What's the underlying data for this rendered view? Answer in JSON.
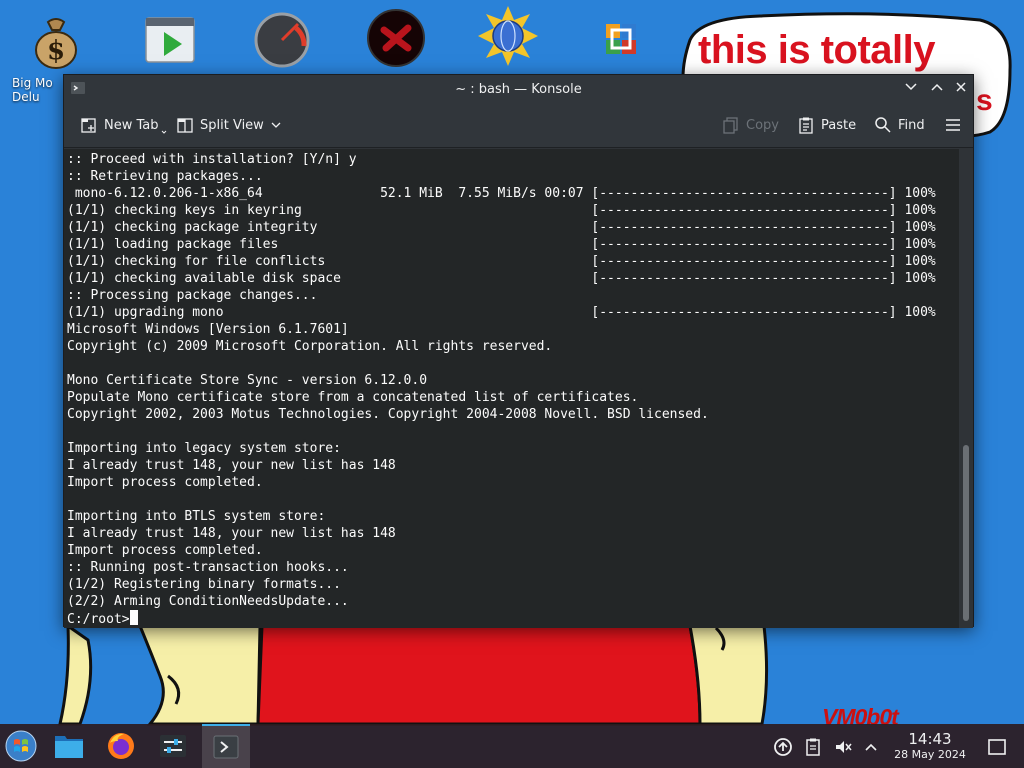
{
  "desktop": {
    "wallpaper_text": "this is totally",
    "wallpaper_text_2": "s",
    "wallpaper_signature": "VM0b0t",
    "icons": [
      {
        "label": "Big Mo\nDelu",
        "icon": "money-bag-icon"
      },
      {
        "label": "",
        "icon": "media-player-icon"
      },
      {
        "label": "",
        "icon": "speedometer-icon"
      },
      {
        "label": "",
        "icon": "red-x-icon"
      },
      {
        "label": "",
        "icon": "globe-icon"
      },
      {
        "label": "",
        "icon": "office-icon"
      }
    ]
  },
  "window": {
    "title": "~ : bash — Konsole"
  },
  "toolbar": {
    "new_tab": "New Tab",
    "split_view": "Split View",
    "copy": "Copy",
    "paste": "Paste",
    "find": "Find"
  },
  "terminal": {
    "lines": [
      ":: Proceed with installation? [Y/n] y",
      ":: Retrieving packages...",
      " mono-6.12.0.206-1-x86_64               52.1 MiB  7.55 MiB/s 00:07 [-------------------------------------] 100%",
      "(1/1) checking keys in keyring                                     [-------------------------------------] 100%",
      "(1/1) checking package integrity                                   [-------------------------------------] 100%",
      "(1/1) loading package files                                        [-------------------------------------] 100%",
      "(1/1) checking for file conflicts                                  [-------------------------------------] 100%",
      "(1/1) checking available disk space                                [-------------------------------------] 100%",
      ":: Processing package changes...",
      "(1/1) upgrading mono                                               [-------------------------------------] 100%",
      "Microsoft Windows [Version 6.1.7601]",
      "Copyright (c) 2009 Microsoft Corporation. All rights reserved.",
      "",
      "Mono Certificate Store Sync - version 6.12.0.0",
      "Populate Mono certificate store from a concatenated list of certificates.",
      "Copyright 2002, 2003 Motus Technologies. Copyright 2004-2008 Novell. BSD licensed.",
      "",
      "Importing into legacy system store:",
      "I already trust 148, your new list has 148",
      "Import process completed.",
      "",
      "Importing into BTLS system store:",
      "I already trust 148, your new list has 148",
      "Import process completed.",
      ":: Running post-transaction hooks...",
      "(1/2) Registering binary formats...",
      "(2/2) Arming ConditionNeedsUpdate..."
    ],
    "prompt": "C:/root>"
  },
  "taskbar": {
    "time": "14:43",
    "date": "28 May 2024"
  },
  "colors": {
    "accent": "#3daee9",
    "terminal_bg": "#232627",
    "terminal_fg": "#fcfcfc",
    "wallpaper_blue": "#2a82d8",
    "wallpaper_red": "#d9121f"
  }
}
